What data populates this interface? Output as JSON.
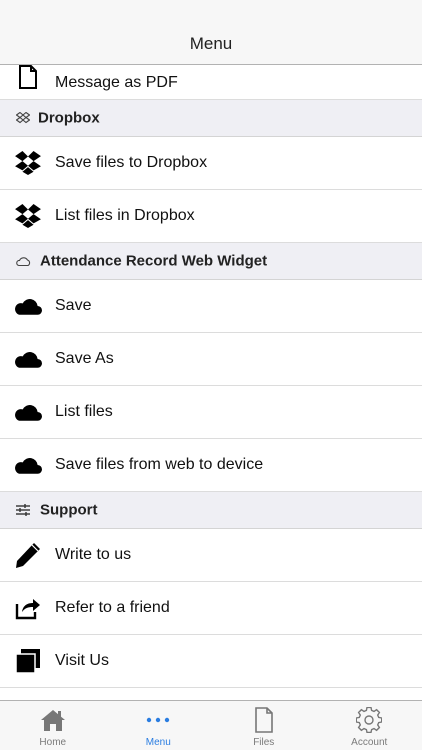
{
  "header": {
    "title": "Menu"
  },
  "items_top": [
    {
      "label": "Message as PDF",
      "icon": "document-icon"
    }
  ],
  "sections": {
    "dropbox": {
      "title": "Dropbox",
      "items": [
        {
          "label": "Save files to Dropbox",
          "icon": "dropbox-icon"
        },
        {
          "label": "List files in Dropbox",
          "icon": "dropbox-icon"
        }
      ]
    },
    "web_widget": {
      "title": "Attendance Record Web Widget",
      "items": [
        {
          "label": "Save",
          "icon": "cloud-icon"
        },
        {
          "label": "Save As",
          "icon": "cloud-icon"
        },
        {
          "label": "List files",
          "icon": "cloud-icon"
        },
        {
          "label": "Save files from web to device",
          "icon": "cloud-icon"
        }
      ]
    },
    "support": {
      "title": "Support",
      "items": [
        {
          "label": "Write to us",
          "icon": "pencil-icon"
        },
        {
          "label": "Refer to a friend",
          "icon": "share-icon"
        },
        {
          "label": "Visit Us",
          "icon": "windows-icon"
        }
      ]
    }
  },
  "tabs": [
    {
      "label": "Home",
      "icon": "home-icon"
    },
    {
      "label": "Menu",
      "icon": "more-dots-icon",
      "active": true
    },
    {
      "label": "Files",
      "icon": "file-icon"
    },
    {
      "label": "Account",
      "icon": "gear-icon"
    }
  ],
  "colors": {
    "accent": "#2a7de1",
    "section_bg": "#efeff4",
    "bar_bg": "#f7f7f7"
  }
}
